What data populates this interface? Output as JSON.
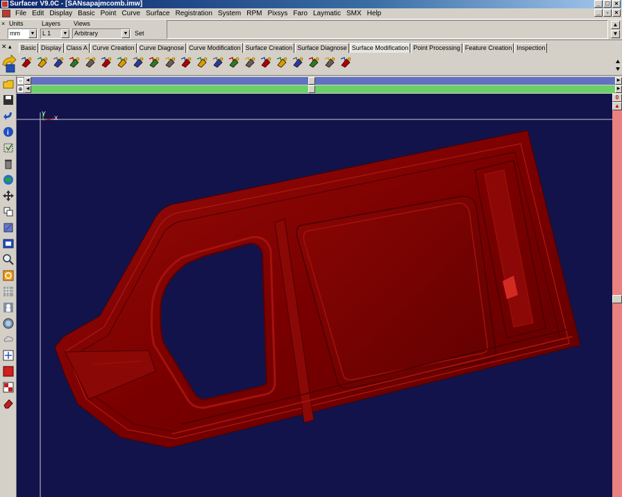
{
  "window": {
    "title": "Surfacer V9.0C - [SANsapajmcomb.imw]"
  },
  "menu": [
    "File",
    "Edit",
    "Display",
    "Basic",
    "Point",
    "Curve",
    "Surface",
    "Registration",
    "System",
    "RPM",
    "Pixsys",
    "Faro",
    "Laymatic",
    "SMX",
    "Help"
  ],
  "settings": {
    "units_label": "Units",
    "units_value": "mm",
    "layers_label": "Layers",
    "layers_value": "L 1",
    "views_label": "Views",
    "views_value": "Arbitrary",
    "set_label": "Set"
  },
  "tabs": [
    {
      "label": "Basic",
      "active": false
    },
    {
      "label": "Display",
      "active": false
    },
    {
      "label": "Class A",
      "active": false
    },
    {
      "label": "Curve Creation",
      "active": false
    },
    {
      "label": "Curve Diagnose",
      "active": false
    },
    {
      "label": "Curve Modification",
      "active": false
    },
    {
      "label": "Surface Creation",
      "active": false
    },
    {
      "label": "Surface Diagnose",
      "active": false
    },
    {
      "label": "Surface Modification",
      "active": true
    },
    {
      "label": "Point Processing",
      "active": false
    },
    {
      "label": "Feature Creation",
      "active": false
    },
    {
      "label": "Inspection",
      "active": false
    }
  ],
  "toolbar_icons": [
    "trim-surface-icon",
    "extend-surface-icon",
    "offset-surface-icon",
    "blend-surface-icon",
    "split-surface-icon",
    "join-surface-icon",
    "fillet-surface-icon",
    "reparameterize-icon",
    "smooth-surface-icon",
    "solid-box-icon",
    "untrim-icon",
    "merge-surface-icon",
    "deform-surface-icon",
    "hand-modify-icon",
    "match-surface-icon",
    "flip-normal-icon",
    "move-cv-icon",
    "globe-surface-icon",
    "remove-knot-icon",
    "insert-knot-icon",
    "delete-surface-icon"
  ],
  "left_icons": [
    "open-folder-icon",
    "save-icon",
    "undo-icon",
    "info-icon",
    "select-all-icon",
    "trash-icon",
    "globe-icon",
    "move-icon",
    "copy-icon",
    "transform-icon",
    "fit-view-icon",
    "zoom-icon",
    "rotate-view-icon",
    "pattern-icon",
    "view-person-icon",
    "zoom-globe-icon",
    "cloud-icon",
    "snap-icon",
    "color-icon",
    "grid-icon",
    "eraser-icon"
  ],
  "viewport": {
    "background": "#12134a",
    "model_color": "#7a0000",
    "axis_y": "Y",
    "axis_x": "X"
  },
  "sliders": {
    "top_color": "#6272c2",
    "bottom_color": "#6bd068",
    "top_value": 0.48,
    "bottom_value": 0.48
  },
  "scrollbar": {
    "top_button": "0",
    "color": "#e8817f"
  }
}
